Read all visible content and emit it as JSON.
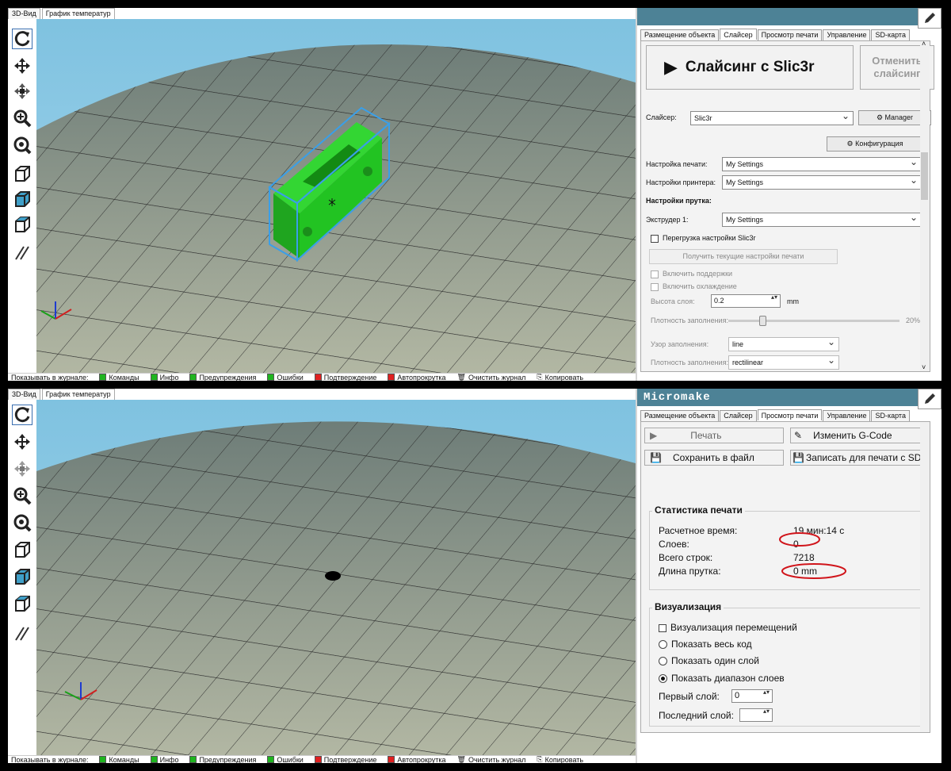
{
  "top": {
    "view_tabs": [
      "3D-Вид",
      "График температур"
    ],
    "right_title": "",
    "right_tabs": [
      "Размещение объекта",
      "Слайсер",
      "Просмотр печати",
      "Управление",
      "SD-карта"
    ],
    "active_right_tab": 1,
    "slice_button": "Слайсинг с Slic3r",
    "cancel_slice_button": "Отменить слайсинг",
    "slicer_label": "Слайсер:",
    "slicer_value": "Slic3r",
    "manager_button": "Manager",
    "config_button": "Конфигурация",
    "print_setting_label": "Настройка печати:",
    "print_setting_value": "My Settings",
    "printer_setting_label": "Настройки принтера:",
    "printer_setting_value": "My Settings",
    "filament_header": "Настройки прутка:",
    "extruder_label": "Экструдер 1:",
    "extruder_value": "My Settings",
    "override_label": "Перегрузка настройки Slic3r",
    "get_settings_button": "Получить текущие настройки печати",
    "support_label": "Включить поддержки",
    "cooling_label": "Включить охлаждение",
    "layer_height_label": "Высота слоя:",
    "layer_height_value": "0.2",
    "layer_height_unit": "mm",
    "infill_density_label": "Плотность заполнения:",
    "infill_density_value": "20%",
    "infill_density_level": 0.2,
    "infill_pattern_label": "Узор заполнения:",
    "infill_pattern_value": "line",
    "solid_pattern_label": "Плотность заполнения:",
    "solid_pattern_value": "rectilinear"
  },
  "bottom": {
    "view_tabs": [
      "3D-Вид",
      "График температур"
    ],
    "right_title": "Micromake",
    "right_tabs": [
      "Размещение объекта",
      "Слайсер",
      "Просмотр печати",
      "Управление",
      "SD-карта"
    ],
    "active_right_tab": 2,
    "print_button": "Печать",
    "edit_gcode_button": "Изменить G-Code",
    "save_file_button": "Сохранить в файл",
    "write_sd_button": "Записать для печати с SD",
    "stats_title": "Статистика печати",
    "stats": [
      {
        "label": "Расчетное время:",
        "value": "19 мин:14 с"
      },
      {
        "label": "Слоев:",
        "value": "0"
      },
      {
        "label": "Всего строк:",
        "value": "7218"
      },
      {
        "label": "Длина прутка:",
        "value": "0 mm"
      }
    ],
    "vis_title": "Визуализация",
    "show_moves_label": "Визуализация перемещений",
    "radio_all": "Показать весь код",
    "radio_one": "Показать один слой",
    "radio_range": "Показать диапазон слоев",
    "first_layer_label": "Первый слой:",
    "first_layer_value": "0",
    "last_layer_label": "Последний слой:",
    "last_layer_value": ""
  },
  "logbar": {
    "label": "Показывать в журнале:",
    "items": [
      {
        "label": "Команды",
        "color": "#1fb51f"
      },
      {
        "label": "Инфо",
        "color": "#1fb51f"
      },
      {
        "label": "Предупреждения",
        "color": "#1fb51f"
      },
      {
        "label": "Ошибки",
        "color": "#1fb51f"
      },
      {
        "label": "Подтверждение",
        "color": "#e02020"
      },
      {
        "label": "Автопрокрутка",
        "color": "#e02020"
      }
    ],
    "clear_log": "Очистить журнал",
    "copy": "Копировать"
  },
  "colors": {
    "accent": "#4d8296",
    "model": "#22c322",
    "highlight": "#3a9fe8",
    "annotation": "#d0141a"
  }
}
